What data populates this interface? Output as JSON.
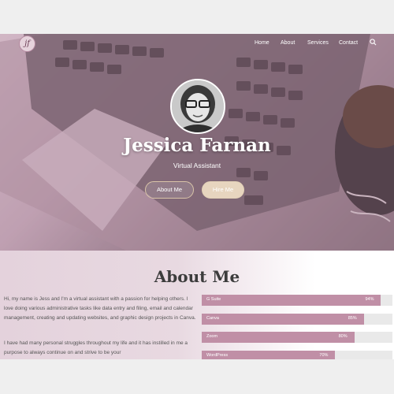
{
  "brand": {
    "logo_text": "jf"
  },
  "nav": {
    "items": [
      "Home",
      "About",
      "Services",
      "Contact"
    ],
    "search_icon": "search-icon"
  },
  "hero": {
    "name": "Jessica Farnan",
    "tagline": "Virtual Assistant",
    "about_button": "About Me",
    "hire_button": "Hire Me"
  },
  "about": {
    "title": "About Me",
    "paragraph1": "Hi, my name is Jess and I'm a virtual assistant with a passion for helping others. I love doing various administrative tasks like data entry and filing, email and calendar management, creating and updating websites, and graphic design projects in Canva.",
    "paragraph2": "I have had many personal struggles throughout my life and it has instilled in me a purpose to always continue on and strive to be your"
  },
  "skills": [
    {
      "name": "G Suite",
      "level": 94,
      "label": "94%"
    },
    {
      "name": "Canva",
      "level": 85,
      "label": "85%"
    },
    {
      "name": "Zoom",
      "level": 80,
      "label": "80%"
    },
    {
      "name": "WordPress",
      "level": 70,
      "label": "70%"
    }
  ],
  "colors": {
    "accent": "#c08fa6",
    "button_beige": "#e7d5bf"
  }
}
